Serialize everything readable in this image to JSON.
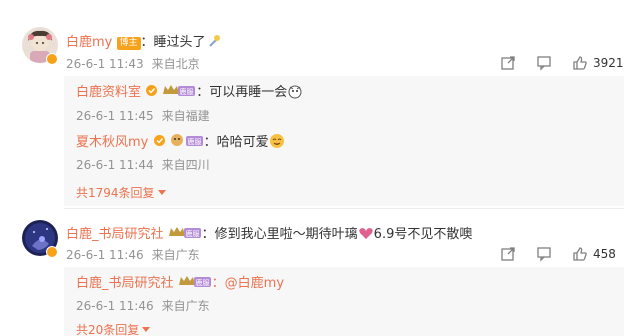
{
  "comments": [
    {
      "user": "白鹿my",
      "tag": "博主",
      "text": "：睡过头了",
      "date": "26-6-1 11:43",
      "location": "来自北京",
      "like_count": "3921",
      "replies": [
        {
          "user": "白鹿资料室",
          "vip_label": "鹿服",
          "text": "：可以再睡一会",
          "date": "26-6-1 11:45",
          "location": "来自福建"
        },
        {
          "user": "夏木秋风my",
          "vip_label": "鹿服",
          "text": "：哈哈可爱",
          "date": "26-6-1 11:44",
          "location": "来自四川"
        }
      ],
      "more_replies": "共1794条回复"
    },
    {
      "user": "白鹿_书局研究社",
      "vip_label": "鹿服",
      "text": "：修到我心里啦～期待叶璃",
      "text_after_emoji": "6.9号不见不散噢",
      "date": "26-6-1 11:46",
      "location": "来自广东",
      "like_count": "458",
      "replies": [
        {
          "user": "白鹿_书局研究社",
          "vip_label": "鹿服",
          "text": "：@白鹿my",
          "date": "26-6-1 11:46",
          "location": "来自广东"
        }
      ],
      "more_replies": "共20条回复"
    }
  ],
  "colors": {
    "username": "#eb7350",
    "meta": "#939393",
    "reply_bg": "#f7f7f7",
    "tag": "#f7a21b"
  },
  "icons": [
    "share-icon",
    "comment-icon",
    "like-icon",
    "verified-icon",
    "crown-icon"
  ]
}
